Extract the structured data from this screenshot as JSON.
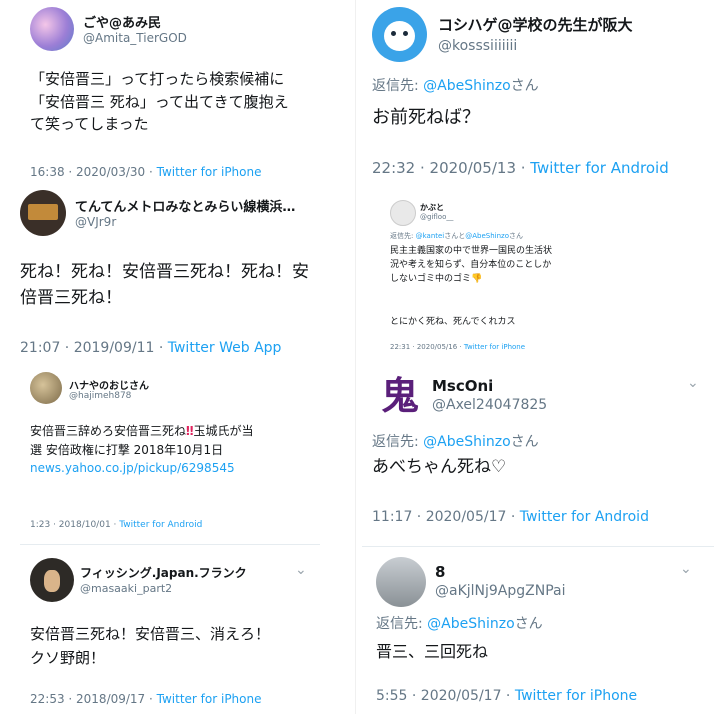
{
  "tweets": [
    {
      "name": "ごや@あみ民",
      "handle": "@Amita_TierGOD",
      "body": "「安倍晋三」って打ったら検索候補に「安倍晋三 死ね」って出てきて腹抱えて笑ってしまった",
      "time": "16:38 · 2020/03/30 · ",
      "source": "Twitter for iPhone"
    },
    {
      "name": "てんてんメトロみなとみらい線横浜…",
      "handle": "@VJr9r",
      "body": "死ね！死ね！安倍晋三死ね！死ね！安倍晋三死ね！",
      "time": "21:07 · 2019/09/11 · ",
      "source": "Twitter Web App"
    },
    {
      "name": "ハナやのおじさん",
      "handle": "@hajimeh878",
      "body_a": "安倍晋三辞めろ安倍晋三死ね",
      "body_mark": "‼",
      "body_b": "玉城氏が当選 安倍政権に打撃 2018年10月1日 ",
      "body_link": "news.yahoo.co.jp/pickup/6298545",
      "time": "1:23 · 2018/10/01 · ",
      "source": "Twitter for Android"
    },
    {
      "name": "フィッシング.Japan.フランク",
      "handle": "@masaaki_part2",
      "body": "安倍晋三死ね！安倍晋三、消えろ！クソ野朗！",
      "time": "22:53 · 2018/09/17 · ",
      "source": "Twitter for iPhone"
    },
    {
      "name": "コシハゲ@学校の先生が阪大",
      "handle": "@kosssiiiiiii",
      "reply_prefix": "返信先: ",
      "reply_to": "@AbeShinzo",
      "reply_suffix": "さん",
      "body": "お前死ねば？",
      "time": "22:32 · 2020/05/13 · ",
      "source": "Twitter for Android"
    },
    {
      "name": "かぶと",
      "handle": "@gifloo__",
      "reply_prefix": "返信先: ",
      "reply_to": "@kantei",
      "reply_mid": "さんと",
      "reply_to2": "@AbeShinzo",
      "reply_suffix": "さん",
      "body": "民主主義国家の中で世界一国民の生活状況や考えを知らず、自分本位のことしかしないゴミ中のゴミ👎",
      "body2": "とにかく死ね、死んでくれカス",
      "time": "22:31 · 2020/05/16 · ",
      "source": "Twitter for iPhone"
    },
    {
      "name": "MscOni",
      "handle": "@Axel24047825",
      "avatar_char": "鬼",
      "reply_prefix": "返信先: ",
      "reply_to": "@AbeShinzo",
      "reply_suffix": "さん",
      "body": "あべちゃん死ね♡",
      "time": "11:17 · 2020/05/17 · ",
      "source": "Twitter for Android"
    },
    {
      "name": "8",
      "handle": "@aKjlNj9ApgZNPai",
      "reply_prefix": "返信先: ",
      "reply_to": "@AbeShinzo",
      "reply_suffix": "さん",
      "body": "晋三、三回死ね",
      "time": "5:55 · 2020/05/17 · ",
      "source": "Twitter for iPhone"
    }
  ],
  "icons": {
    "chevron": "chevron-down-icon"
  }
}
